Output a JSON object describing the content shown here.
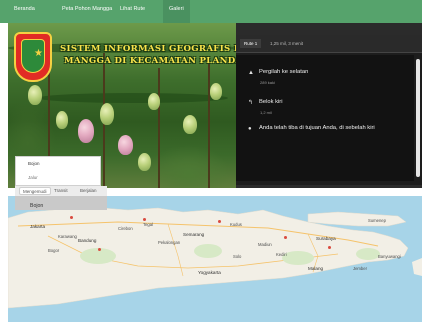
{
  "nav": {
    "items": [
      {
        "label": "Beranda"
      },
      {
        "label": "Peta Pohon Mangga"
      },
      {
        "label": "Lihat Rute"
      },
      {
        "label": "Galeri"
      }
    ]
  },
  "header": {
    "title_line1": "SISTEM INFORMASI GEOGRAFIS POHON",
    "title_line2": "MANGGA DI KECAMATAN PLANDAAN"
  },
  "route": {
    "tab_label": "Rute 1",
    "summary": "1,25 mil, 3 menit",
    "steps": [
      {
        "text": "Pergilah ke selatan",
        "distance": "289 kaki",
        "icon": "arrow-up-icon"
      },
      {
        "text": "Belok kiri",
        "distance": "1,2 mil",
        "icon": "turn-left-icon"
      },
      {
        "text": "Anda telah tiba di tujuan Anda, di sebelah kiri",
        "distance": "",
        "icon": "destination-pin-icon"
      }
    ]
  },
  "inputs": {
    "origin_value": "Bojon",
    "origin_placeholder": "Bojon",
    "destination_value": "",
    "destination_placeholder": "Jalur"
  },
  "modes": [
    {
      "label": "Mengemudi",
      "active": true
    },
    {
      "label": "Transit",
      "active": false
    },
    {
      "label": "Berjalan",
      "active": false
    }
  ],
  "origin_label": "Bojon",
  "map": {
    "labels": [
      {
        "text": "Jakarta",
        "kind": "city"
      },
      {
        "text": "Bandung",
        "kind": "city"
      },
      {
        "text": "Semarang",
        "kind": "city"
      },
      {
        "text": "Surabaya",
        "kind": "city"
      },
      {
        "text": "Yogyakarta",
        "kind": "city"
      },
      {
        "text": "Malang",
        "kind": "city"
      },
      {
        "text": "Bogor",
        "kind": "place"
      },
      {
        "text": "Cirebon",
        "kind": "place"
      },
      {
        "text": "Tegal",
        "kind": "place"
      },
      {
        "text": "Pekalongan",
        "kind": "place"
      },
      {
        "text": "Kudus",
        "kind": "place"
      },
      {
        "text": "Solo",
        "kind": "place"
      },
      {
        "text": "Kediri",
        "kind": "place"
      },
      {
        "text": "Madiun",
        "kind": "place"
      },
      {
        "text": "Jember",
        "kind": "place"
      },
      {
        "text": "Banyuwangi",
        "kind": "place"
      },
      {
        "text": "Sumenep",
        "kind": "place"
      },
      {
        "text": "Karawang",
        "kind": "place"
      }
    ]
  },
  "colors": {
    "nav_bg": "#56a36c",
    "title_yellow": "#f7e24b",
    "panel_bg": "#1d1d1d",
    "sea": "#a7d4e8",
    "land": "#f2efe6"
  }
}
